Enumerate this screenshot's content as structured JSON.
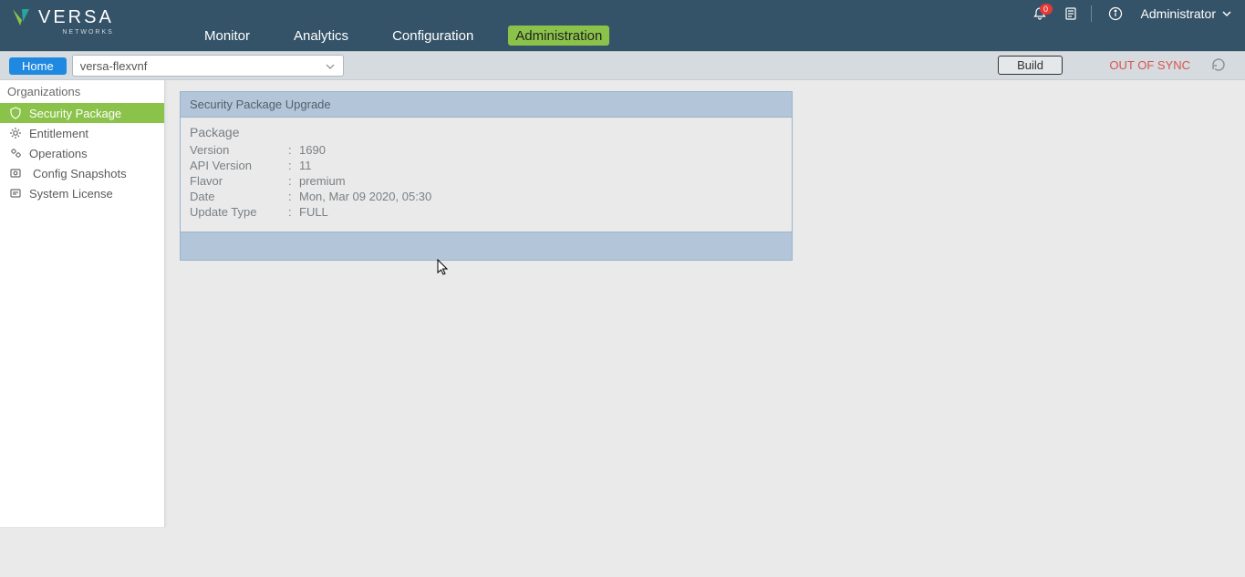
{
  "brand": {
    "name": "VERSA",
    "sub": "NETWORKS"
  },
  "main_tabs": [
    {
      "label": "Monitor"
    },
    {
      "label": "Analytics"
    },
    {
      "label": "Configuration"
    },
    {
      "label": "Administration"
    }
  ],
  "top_right": {
    "notif_count": "0",
    "user_label": "Administrator"
  },
  "secondary": {
    "home_label": "Home",
    "device": "versa-flexvnf",
    "build_label": "Build",
    "sync_status": "OUT OF SYNC"
  },
  "sidebar": {
    "title": "Organizations",
    "items": [
      {
        "label": "Security Package"
      },
      {
        "label": "Entitlement"
      },
      {
        "label": "Operations"
      },
      {
        "label": "Config Snapshots"
      },
      {
        "label": "System License"
      }
    ]
  },
  "panel": {
    "title": "Security Package Upgrade",
    "section": "Package",
    "rows": [
      {
        "k": "Version",
        "v": "1690"
      },
      {
        "k": "API Version",
        "v": "11"
      },
      {
        "k": "Flavor",
        "v": "premium"
      },
      {
        "k": "Date",
        "v": "Mon, Mar 09 2020, 05:30"
      },
      {
        "k": "Update Type",
        "v": "FULL"
      }
    ]
  }
}
